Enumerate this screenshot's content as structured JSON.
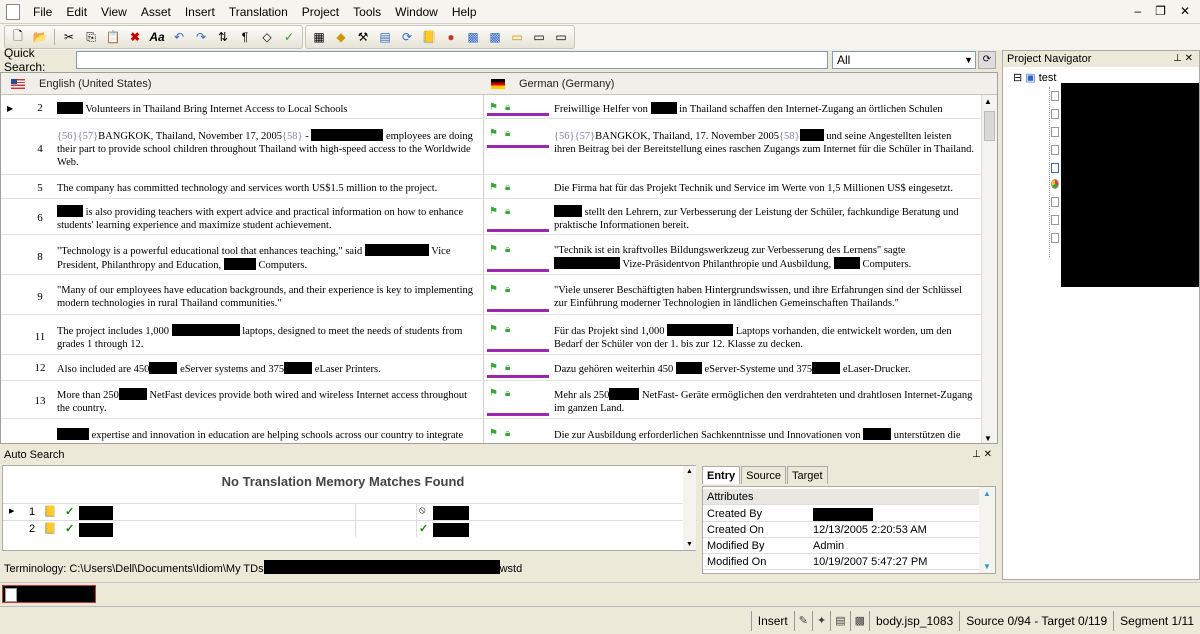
{
  "menu": [
    "File",
    "Edit",
    "View",
    "Asset",
    "Insert",
    "Translation",
    "Project",
    "Tools",
    "Window",
    "Help"
  ],
  "quick_search": {
    "label": "Quick Search:",
    "value": "",
    "scope": "All"
  },
  "grid": {
    "source_lang": "English (United States)",
    "target_lang": "German (Germany)",
    "rows": [
      {
        "num": "2",
        "src": [
          "",
          " Volunteers in Thailand Bring Internet Access to Local Schools"
        ],
        "tgt": [
          "Freiwillige Helfer von ",
          " in Thailand schaffen den Internet-Zugang an örtlichen Schulen"
        ]
      },
      {
        "num": "4",
        "src_tags": "{56}{57}",
        "src": [
          "BANGKOK, Thailand, November 17, 2005",
          " - ",
          " employees are doing their part to provide school children throughout Thailand with high-speed access to the Worldwide Web."
        ],
        "tgt_tags": "{56}{57}",
        "tgt": [
          "BANGKOK, Thailand, 17. November 2005",
          " und seine Angestellten leisten ihren Beitrag bei der Bereitstellung eines raschen Zugangs zum Internet für die Schüler in Thailand."
        ],
        "tag58": "{58}"
      },
      {
        "num": "5",
        "src": [
          "The company has committed technology and services worth US$1.5 million to the project."
        ],
        "tgt": [
          "Die Firma hat für das Projekt Technik und Service im Werte von 1,5 Millionen US$ eingesetzt."
        ]
      },
      {
        "num": "6",
        "src": [
          "",
          " is also providing teachers with expert advice and practical information on how to enhance students' learning experience and maximize student achievement."
        ],
        "tgt": [
          "",
          " stellt den Lehrern, zur Verbesserung der Leistung der Schüler, fachkundige Beratung und praktische Informationen bereit."
        ]
      },
      {
        "num": "8",
        "src": [
          "\"Technology is a powerful educational tool that enhances teaching,\" said ",
          " Vice President, Philanthropy and Education, ",
          " Computers."
        ],
        "tgt": [
          "\"Technik ist ein kraftvolles Bildungswerkzeug zur Verbesserung des Lernens\" sagte ",
          " Vize-Präsidentvon Philanthropie und Ausbildung, ",
          " Computers."
        ]
      },
      {
        "num": "9",
        "src": [
          "\"Many of our employees have education backgrounds, and their experience is key to implementing modern technologies in rural Thailand communities.\""
        ],
        "tgt": [
          "\"Viele unserer Beschäftigten haben Hintergrundswissen, und ihre Erfahrungen sind der Schlüssel zur Einführung moderner Technologien in ländlichen Gemeinschaften Thailands.\""
        ]
      },
      {
        "num": "11",
        "src": [
          "The project includes 1,000 ",
          " laptops, designed to meet the needs of students from grades 1 through 12."
        ],
        "tgt": [
          "Für das Projekt sind 1,000 ",
          " Laptops vorhanden, die entwickelt worden, um den Bedarf der Schüler von der 1. bis zur 12. Klasse zu decken."
        ]
      },
      {
        "num": "12",
        "src": [
          "Also included are 450",
          " eServer systems and 375",
          " eLaser Printers."
        ],
        "tgt": [
          "Dazu gehören weiterhin 450 ",
          " eServer-Systeme und 375",
          " eLaser-Drucker."
        ]
      },
      {
        "num": "13",
        "src": [
          "More than 250",
          " NetFast devices provide both wired and wireless Internet access throughout the country."
        ],
        "tgt": [
          "Mehr als 250",
          " NetFast- Geräte ermöglichen den verdrahteten und drahtlosen Internet-Zugang im ganzen Land."
        ]
      },
      {
        "num": "",
        "src": [
          "",
          " expertise and innovation in education are helping schools across our country to integrate"
        ],
        "tgt": [
          "Die zur Ausbildung erforderlichen Sachkenntnisse und Innovationen von ",
          " unterstützen die"
        ]
      }
    ]
  },
  "auto_search": {
    "title": "Auto Search",
    "message": "No Translation Memory Matches Found",
    "rows": [
      {
        "n": "1"
      },
      {
        "n": "2"
      }
    ]
  },
  "terminology": {
    "label": "Terminology: C:\\Users\\Dell\\Documents\\Idiom\\My TDs",
    "suffix": "wstd"
  },
  "attributes": {
    "tabs": [
      "Entry",
      "Source",
      "Target"
    ],
    "header": "Attributes",
    "rows": [
      {
        "k": "Created By",
        "v": ""
      },
      {
        "k": "Created On",
        "v": "12/13/2005 2:20:53 AM"
      },
      {
        "k": "Modified By",
        "v": "Admin"
      },
      {
        "k": "Modified On",
        "v": "10/19/2007 5:47:27 PM"
      }
    ]
  },
  "navigator": {
    "title": "Project Navigator",
    "root": "test"
  },
  "statusbar": {
    "mode": "Insert",
    "file": "body.jsp_1083",
    "counts": "Source 0/94 - Target 0/119",
    "segment": "Segment 1/11"
  }
}
